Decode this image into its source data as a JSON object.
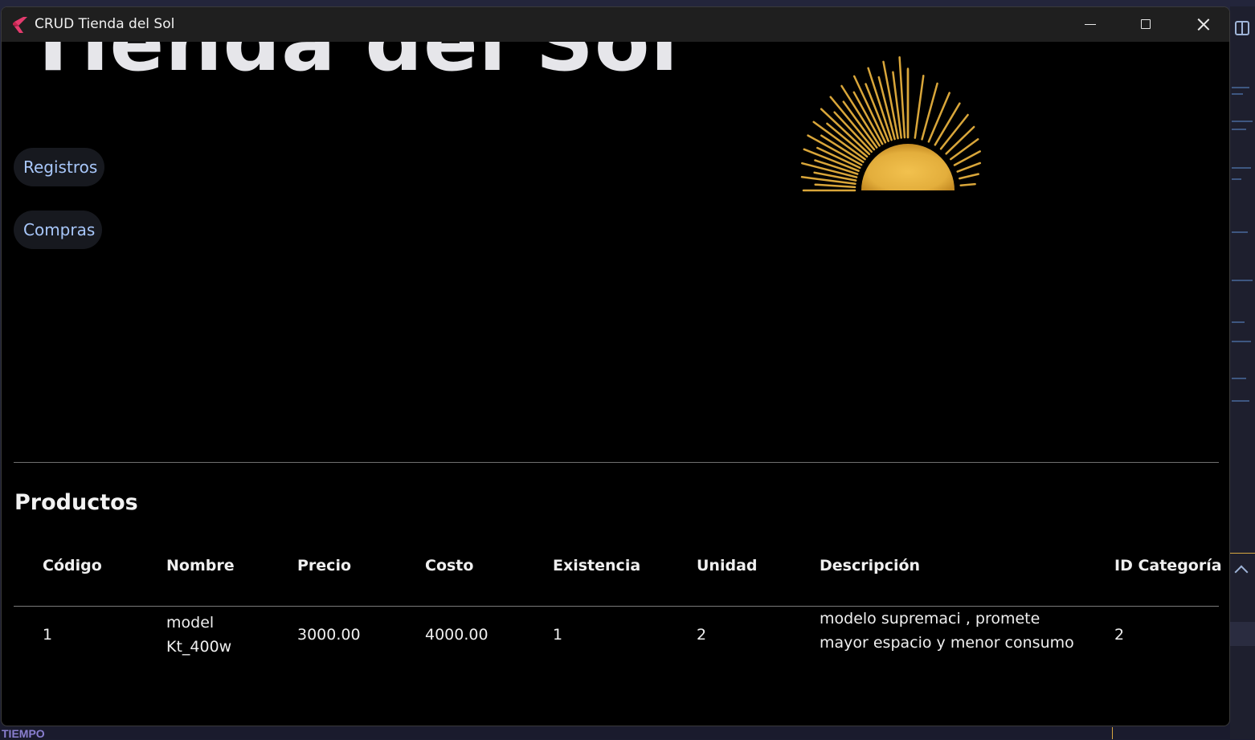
{
  "window": {
    "title": "CRUD Tienda del Sol"
  },
  "hero": {
    "title": "Tienda del Sol"
  },
  "nav": {
    "registros_label": "Registros",
    "compras_label": "Compras"
  },
  "section": {
    "title": "Productos"
  },
  "table": {
    "columns": {
      "codigo": "Código",
      "nombre": "Nombre",
      "precio": "Precio",
      "costo": "Costo",
      "existencia": "Existencia",
      "unidad": "Unidad",
      "descripcion": "Descripción",
      "id_categoria": "ID Categoría"
    },
    "rows": [
      {
        "codigo": "1",
        "nombre": "model Kt_400w",
        "precio": "3000.00",
        "costo": "4000.00",
        "existencia": "1",
        "unidad": "2",
        "descripcion": "modelo supremaci , promete mayor espacio y menor consumo de energia",
        "id_categoria": "2"
      }
    ]
  },
  "desktop": {
    "bottom_label": "TIEMPO"
  },
  "colors": {
    "window_bg": "#000000",
    "title_bar": "#1f1f1f",
    "nav_text": "#a8c7fa",
    "nav_bg": "#17191f",
    "sun_gold": "#e3ae3c",
    "text": "#efefef"
  },
  "icons": {
    "app": "flutter-logo-icon",
    "minimize": "minimize-icon",
    "maximize": "maximize-icon",
    "close": "close-icon"
  }
}
